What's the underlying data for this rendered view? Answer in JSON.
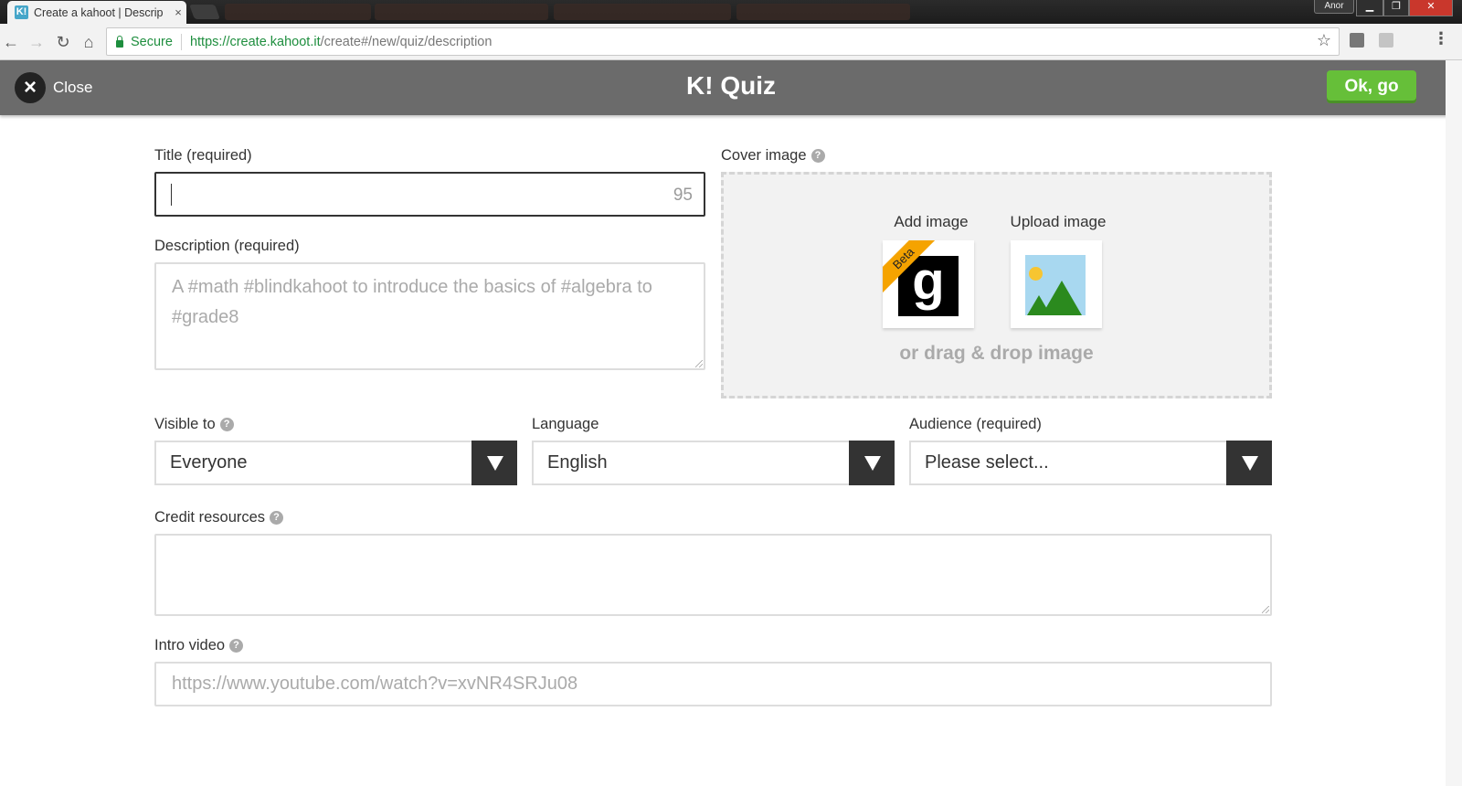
{
  "browser": {
    "tab_title": "Create a kahoot | Descrip",
    "tab_favicon": "K!",
    "tab_close": "×",
    "profile_label": "Anor",
    "secure_label": "Secure",
    "url_host": "https://create.kahoot.it",
    "url_path": "/create#/new/quiz/description",
    "icons": [
      "back-arrow",
      "forward-arrow",
      "reload",
      "home",
      "lock",
      "star",
      "menu"
    ]
  },
  "header": {
    "close_label": "Close",
    "logo": "K!",
    "title": "Quiz",
    "ok_label": "Ok, go"
  },
  "form": {
    "title_label": "Title (required)",
    "title_value": "",
    "title_char_count": "95",
    "description_label": "Description (required)",
    "description_placeholder": "A #math #blindkahoot to introduce the basics of #algebra to #grade8",
    "cover_label": "Cover image",
    "add_image_label": "Add image",
    "beta_badge": "Beta",
    "add_image_logo": "g",
    "upload_image_label": "Upload image",
    "drag_drop_text": "or drag & drop image",
    "visible_to_label": "Visible to",
    "visible_to_value": "Everyone",
    "language_label": "Language",
    "language_value": "English",
    "audience_label": "Audience (required)",
    "audience_value": "Please select...",
    "credit_label": "Credit resources",
    "credit_value": "",
    "intro_video_label": "Intro video",
    "intro_video_placeholder": "https://www.youtube.com/watch?v=xvNR4SRJu08"
  },
  "colors": {
    "header_bg": "#6b6b6b",
    "ok_button": "#66bf39",
    "secure_green": "#1e8e3e",
    "select_arrow_bg": "#333333",
    "beta_ribbon": "#f5a300"
  }
}
